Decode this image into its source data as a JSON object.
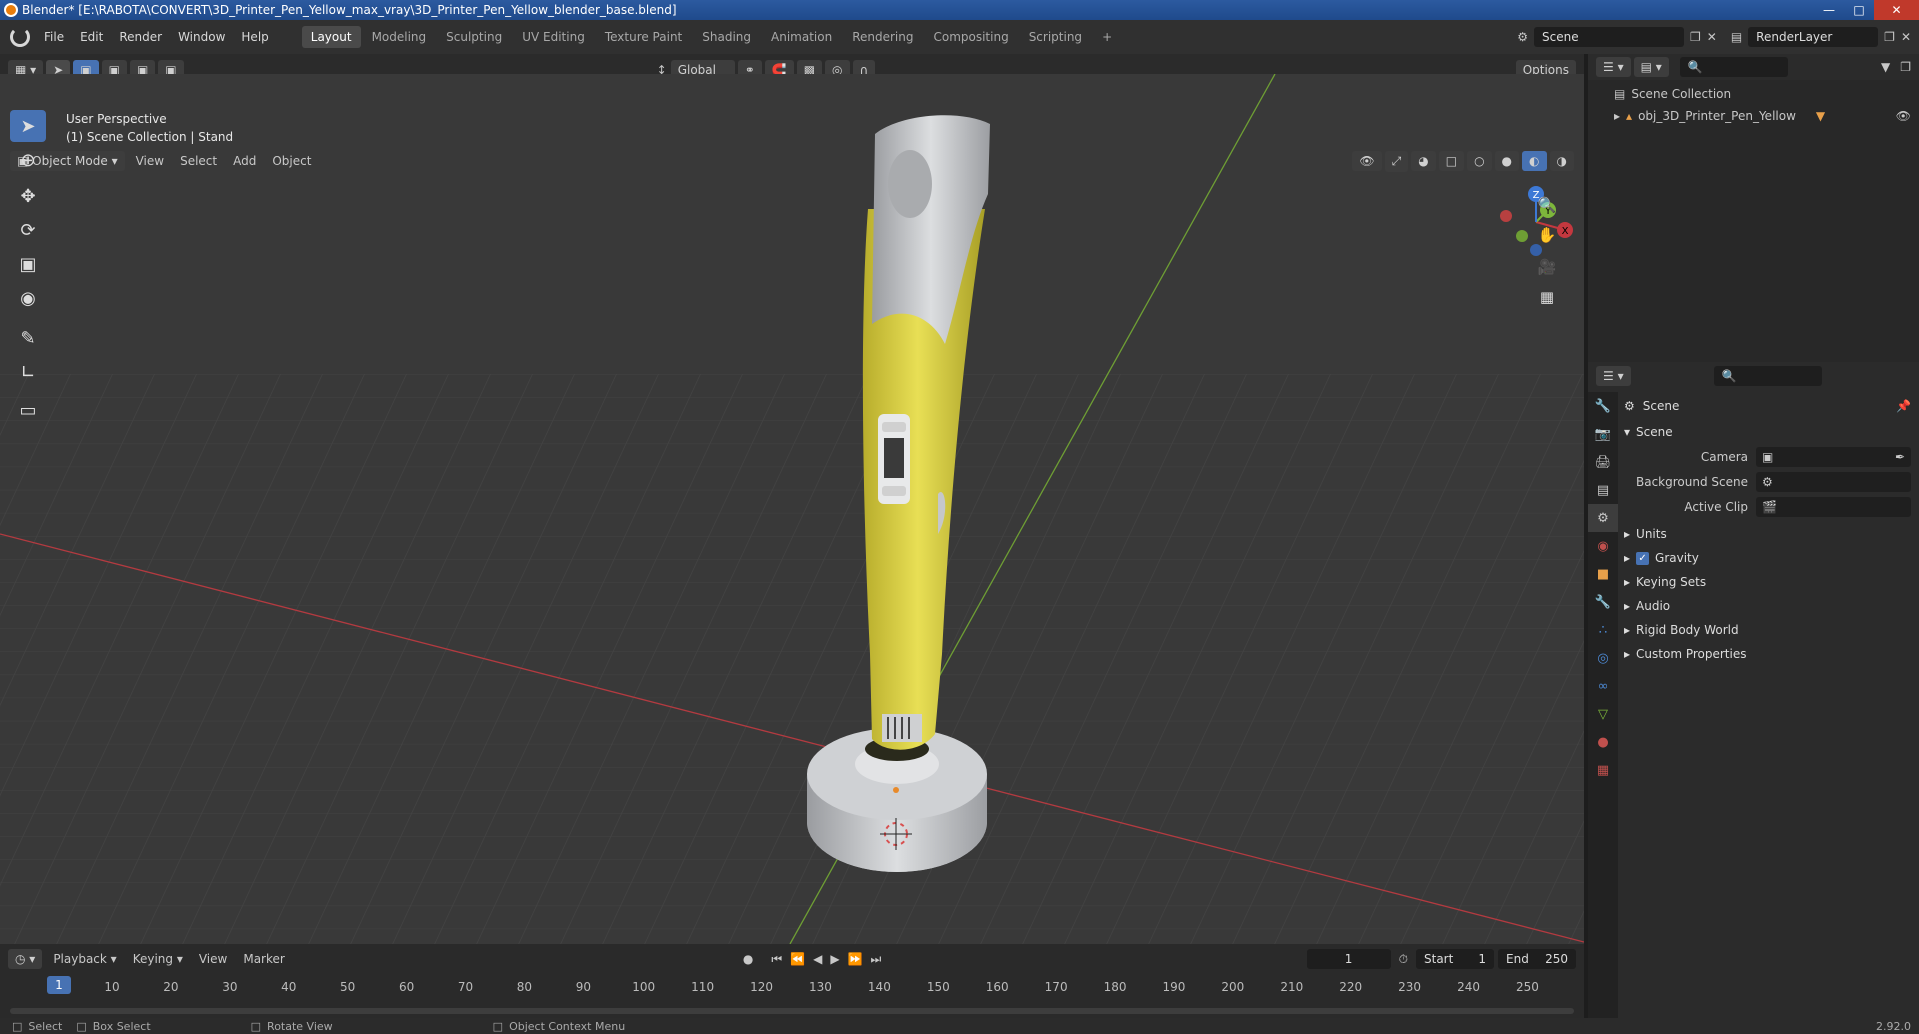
{
  "window": {
    "title": "Blender* [E:\\RABOTA\\CONVERT\\3D_Printer_Pen_Yellow_max_vray\\3D_Printer_Pen_Yellow_blender_base.blend]"
  },
  "menu": {
    "items": [
      "File",
      "Edit",
      "Render",
      "Window",
      "Help"
    ]
  },
  "workspaces": [
    "Layout",
    "Modeling",
    "Sculpting",
    "UV Editing",
    "Texture Paint",
    "Shading",
    "Animation",
    "Rendering",
    "Compositing",
    "Scripting"
  ],
  "active_workspace": "Layout",
  "scene_field": "Scene",
  "render_layer_field": "RenderLayer",
  "viewport_header": {
    "mode": "Object Mode",
    "menus": [
      "View",
      "Select",
      "Add",
      "Object"
    ],
    "transform": "Global",
    "options": "Options"
  },
  "viewport": {
    "perspective": "User Perspective",
    "collection": "(1) Scene Collection | Stand"
  },
  "gizmo": {
    "x": "X",
    "y": "Y",
    "z": "Z"
  },
  "outliner": {
    "root": "Scene Collection",
    "items": [
      {
        "label": "obj_3D_Printer_Pen_Yellow"
      }
    ]
  },
  "properties": {
    "context": "Scene",
    "panel": "Scene",
    "fields": [
      {
        "label": "Camera"
      },
      {
        "label": "Background Scene"
      },
      {
        "label": "Active Clip"
      }
    ],
    "subpanels": [
      "Units",
      "Gravity",
      "Keying Sets",
      "Audio",
      "Rigid Body World",
      "Custom Properties"
    ],
    "gravity_checked": true
  },
  "timeline": {
    "menus": [
      "Playback",
      "Keying",
      "View",
      "Marker"
    ],
    "current_frame": "1",
    "start_label": "Start",
    "start": "1",
    "end_label": "End",
    "end": "250",
    "ticks": [
      "1",
      "10",
      "20",
      "30",
      "40",
      "50",
      "60",
      "70",
      "80",
      "90",
      "100",
      "110",
      "120",
      "130",
      "140",
      "150",
      "160",
      "170",
      "180",
      "190",
      "200",
      "210",
      "220",
      "230",
      "240",
      "250"
    ]
  },
  "statusbar": {
    "select": "Select",
    "box_select": "Box Select",
    "rotate": "Rotate View",
    "context_menu": "Object Context Menu",
    "version": "2.92.0"
  },
  "colors": {
    "accent": "#4772b3",
    "pen_yellow": "#e2d94a",
    "pen_gray": "#c7c9cc",
    "x_axis": "#c4383f",
    "y_axis": "#7db63b"
  }
}
